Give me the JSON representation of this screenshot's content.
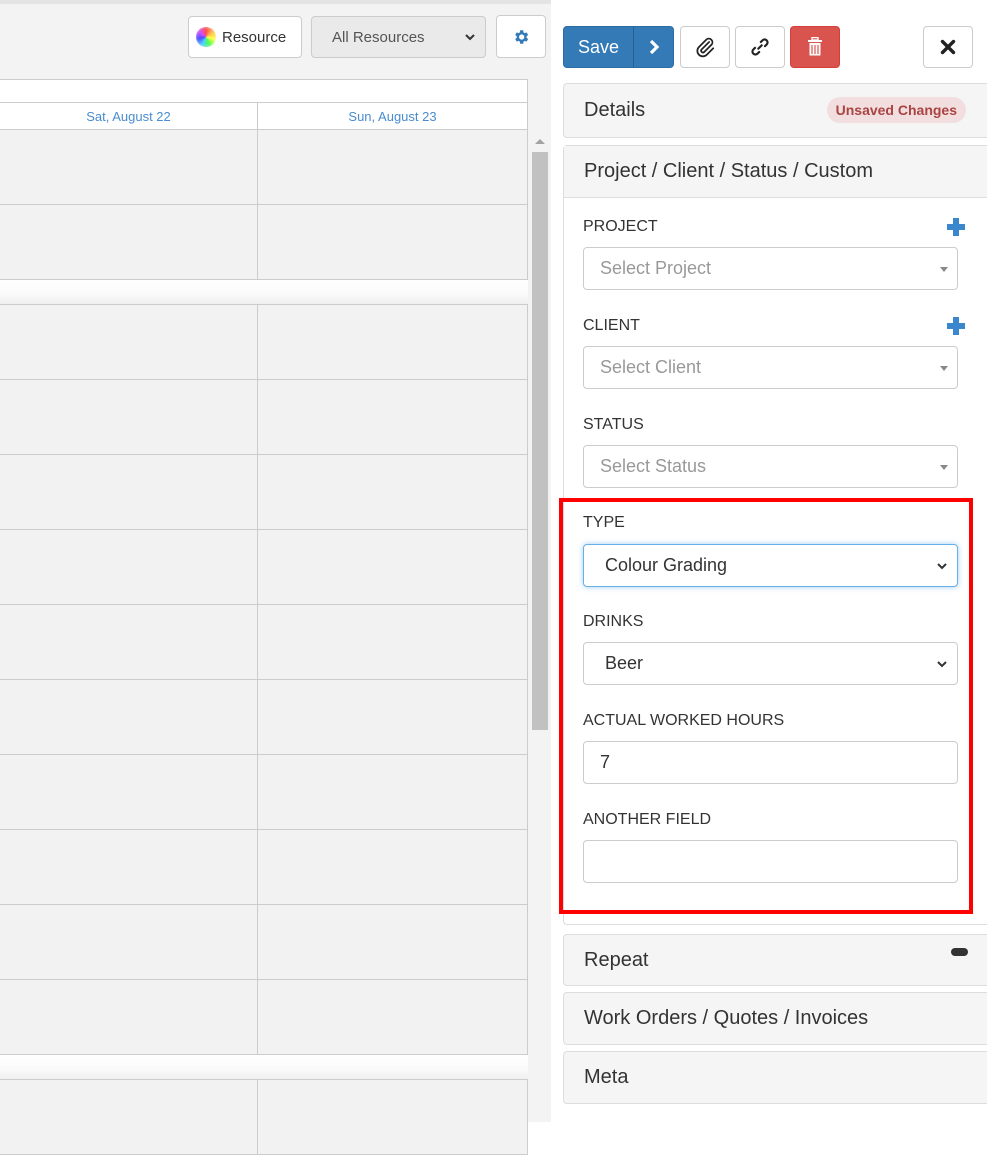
{
  "toolbar": {
    "resource_label": "Resource",
    "resource_filter": "All Resources",
    "icons": {
      "resource": "color-wheel-icon",
      "settings": "gear-icon",
      "dropdown": "chevron-down-icon"
    }
  },
  "calendar": {
    "days": [
      "Sat, August 22",
      "Sun, August 23"
    ],
    "header_color": "#4a8ccf"
  },
  "actions": {
    "save_label": "Save",
    "icons": {
      "save_next": "chevron-right-icon",
      "attach": "paperclip-icon",
      "link": "link-icon",
      "delete": "trash-icon",
      "close": "close-icon"
    },
    "primary_color": "#337ab7",
    "danger_color": "#d9534f"
  },
  "details": {
    "title": "Details",
    "badge": "Unsaved Changes"
  },
  "pcs_panel": {
    "title": "Project / Client / Status / Custom",
    "project": {
      "label": "PROJECT",
      "placeholder": "Select Project"
    },
    "client": {
      "label": "CLIENT",
      "placeholder": "Select Client"
    },
    "status": {
      "label": "STATUS",
      "placeholder": "Select Status"
    },
    "type": {
      "label": "TYPE",
      "value": "Colour Grading"
    },
    "drinks": {
      "label": "DRINKS",
      "value": "Beer"
    },
    "actual_hours": {
      "label": "ACTUAL WORKED HOURS",
      "value": "7"
    },
    "another_field": {
      "label": "ANOTHER FIELD",
      "value": ""
    }
  },
  "sections": {
    "repeat": "Repeat",
    "work_orders": "Work Orders / Quotes / Invoices",
    "meta": "Meta"
  },
  "highlight_color": "#ff0000"
}
